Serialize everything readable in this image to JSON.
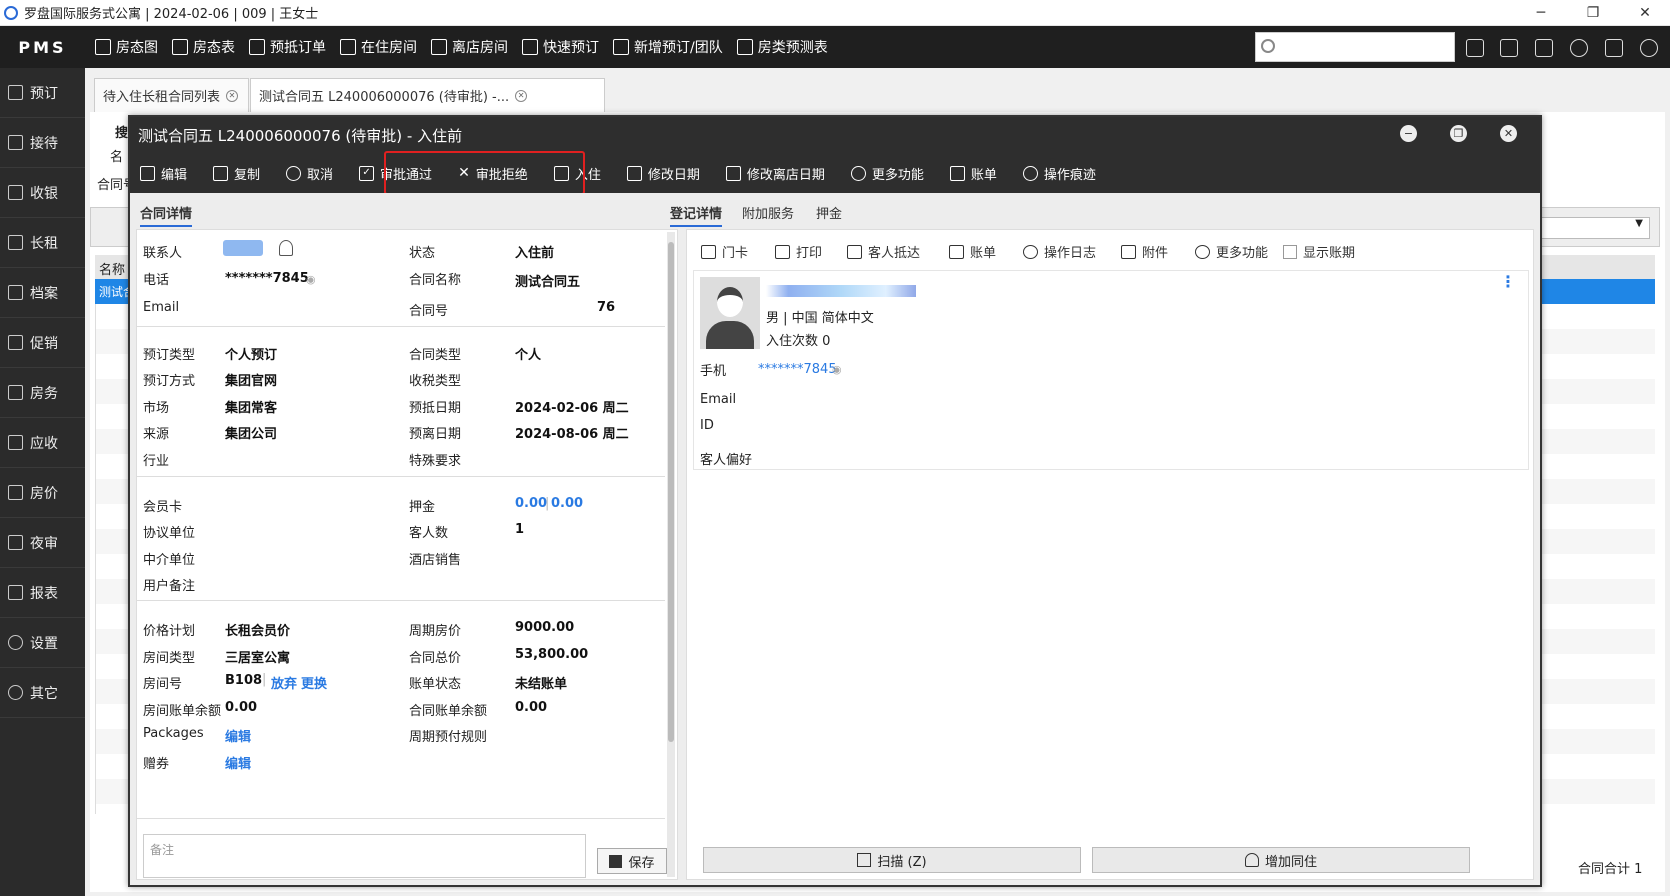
{
  "window": {
    "title": "罗盘国际服务式公寓 | 2024-02-06 | 009 | 王女士"
  },
  "topnav": {
    "brand": "PMS",
    "items": [
      "房态图",
      "房态表",
      "预抵订单",
      "在住房间",
      "离店房间",
      "快速预订",
      "新增预订/团队",
      "房类预测表"
    ],
    "search_placeholder": ""
  },
  "sidebar": {
    "items": [
      "预订",
      "接待",
      "收银",
      "长租",
      "档案",
      "促销",
      "房务",
      "应收",
      "房价",
      "夜审",
      "报表",
      "设置",
      "其它"
    ]
  },
  "tabs": [
    {
      "label": "待入住长租合同列表"
    },
    {
      "label": "测试合同五 L240006000076 (待审批) -..."
    }
  ],
  "background": {
    "partial_labels": [
      "搜",
      "名",
      "合同号",
      "名称",
      "测试合"
    ],
    "footer": "合同合计  1"
  },
  "dialog": {
    "title": "测试合同五 L240006000076 (待审批) - 入住前",
    "toolbar": [
      "编辑",
      "复制",
      "取消",
      "审批通过",
      "审批拒绝",
      "入住",
      "修改日期",
      "修改离店日期",
      "更多功能",
      "账单",
      "操作痕迹"
    ],
    "left": {
      "tab": "合同详情",
      "fields": {
        "contact_label": "联系人",
        "phone_label": "电话",
        "phone": "*******7845",
        "email_label": "Email",
        "status_label": "状态",
        "status": "入住前",
        "contract_name_label": "合同名称",
        "contract_name": "测试合同五",
        "contract_no_label": "合同号",
        "contract_no": "76",
        "booking_type_label": "预订类型",
        "booking_type": "个人预订",
        "booking_method_label": "预订方式",
        "booking_method": "集团官网",
        "market_label": "市场",
        "market": "集团常客",
        "source_label": "来源",
        "source": "集团公司",
        "industry_label": "行业",
        "contract_type_label": "合同类型",
        "contract_type": "个人",
        "tax_type_label": "收税类型",
        "arrival_label": "预抵日期",
        "arrival": "2024-02-06 周二",
        "departure_label": "预离日期",
        "departure": "2024-08-06 周二",
        "special_label": "特殊要求",
        "member_card_label": "会员卡",
        "agreement_label": "协议单位",
        "agent_label": "中介单位",
        "user_note_label": "用户备注",
        "deposit_label": "押金",
        "deposit_a": "0.00",
        "deposit_b": "0.00",
        "guests_label": "客人数",
        "guests": "1",
        "hotel_sales_label": "酒店销售",
        "rate_plan_label": "价格计划",
        "rate_plan": "长租会员价",
        "room_type_label": "房间类型",
        "room_type": "三居室公寓",
        "room_no_label": "房间号",
        "room_no": "B108",
        "room_abandon": "放弃",
        "room_change": "更换",
        "room_balance_label": "房间账单余额",
        "room_balance": "0.00",
        "packages_label": "Packages",
        "packages_link": "编辑",
        "coupon_label": "赠券",
        "coupon_link": "编辑",
        "period_price_label": "周期房价",
        "period_price": "9000.00",
        "total_label": "合同总价",
        "total": "53,800.00",
        "bill_status_label": "账单状态",
        "bill_status": "未结账单",
        "contract_balance_label": "合同账单余额",
        "contract_balance": "0.00",
        "prepay_rule_label": "周期预付规则"
      },
      "note_placeholder": "备注",
      "save": "保存"
    },
    "right": {
      "tabs": [
        "登记详情",
        "附加服务",
        "押金"
      ],
      "toolbar": [
        "门卡",
        "打印",
        "客人抵达",
        "账单",
        "操作日志",
        "附件",
        "更多功能",
        "显示账期"
      ],
      "guest": {
        "info": "男 | 中国  简体中文",
        "visits": "入住次数 0",
        "mobile_label": "手机",
        "mobile": "*******7845",
        "email_label": "Email",
        "id_label": "ID",
        "pref_label": "客人偏好"
      },
      "scan": "扫描 (Z)",
      "add_cohabitant": "增加同住"
    }
  }
}
